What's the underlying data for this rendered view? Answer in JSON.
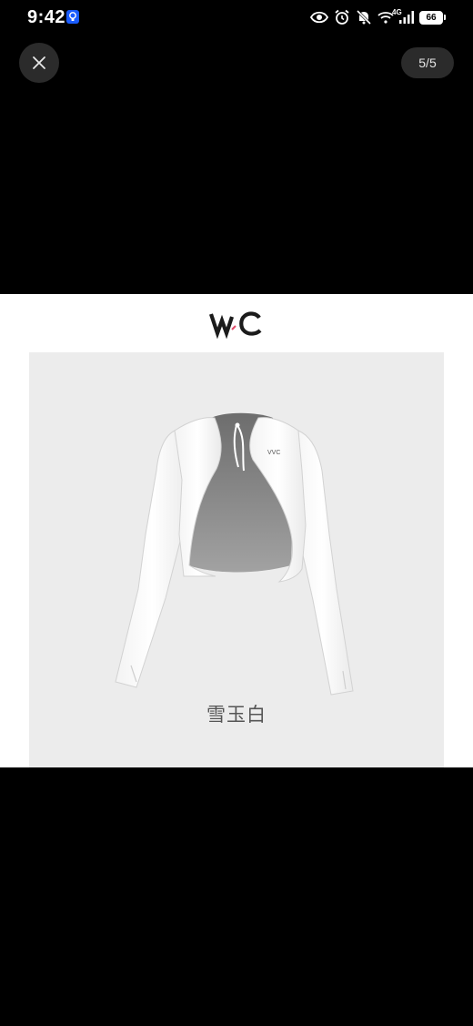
{
  "status_bar": {
    "time": "9:42",
    "network": "4G",
    "battery": "66",
    "icons": [
      "hint-icon",
      "eye-icon",
      "alarm-icon",
      "mute-icon",
      "wifi-icon",
      "signal-icon",
      "battery-icon"
    ]
  },
  "viewer": {
    "close_icon": "close-icon",
    "page_counter": "5/5"
  },
  "product": {
    "brand_logo": "VVC",
    "color_name": "雪玉白"
  }
}
